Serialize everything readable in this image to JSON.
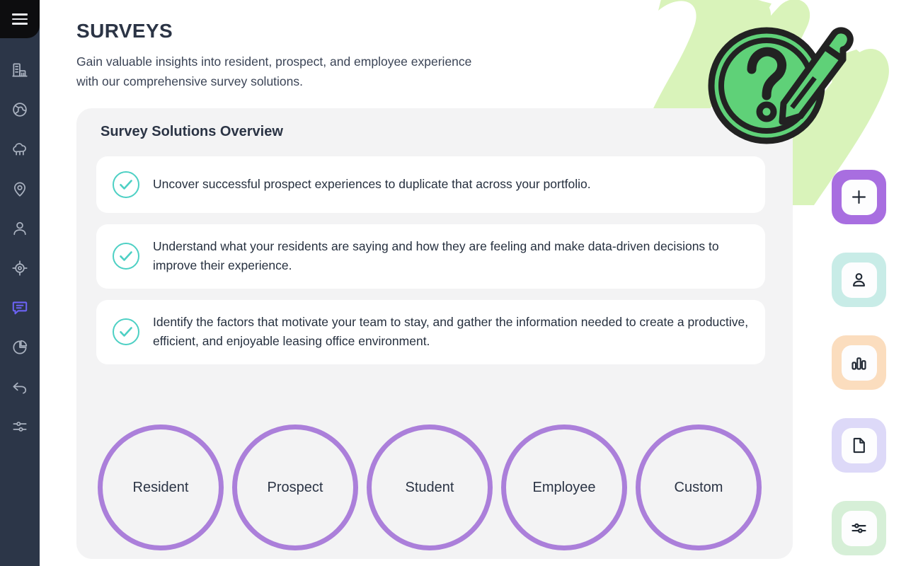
{
  "sidebar": {
    "menu_label": "Menu",
    "items": [
      {
        "name": "sidebar-item-properties",
        "icon": "building-icon",
        "active": false
      },
      {
        "name": "sidebar-item-globe",
        "icon": "globe-icon",
        "active": false
      },
      {
        "name": "sidebar-item-cloud",
        "icon": "cloud-icon",
        "active": false
      },
      {
        "name": "sidebar-item-location",
        "icon": "map-pin-icon",
        "active": false
      },
      {
        "name": "sidebar-item-residents",
        "icon": "user-icon",
        "active": false
      },
      {
        "name": "sidebar-item-target",
        "icon": "target-icon",
        "active": false
      },
      {
        "name": "sidebar-item-surveys",
        "icon": "chat-message-icon",
        "active": true
      },
      {
        "name": "sidebar-item-reports",
        "icon": "pie-chart-icon",
        "active": false
      },
      {
        "name": "sidebar-item-back",
        "icon": "undo-arrow-icon",
        "active": false
      },
      {
        "name": "sidebar-item-settings",
        "icon": "sliders-icon",
        "active": false
      }
    ]
  },
  "header": {
    "title": "SURVEYS",
    "subtitle": "Gain valuable insights into resident, prospect, and employee experience\n with our comprehensive survey solutions."
  },
  "panel": {
    "title": "Survey Solutions Overview",
    "features": [
      "Uncover successful prospect experiences to duplicate that across your portfolio.",
      "Understand what your residents are saying and how they are feeling and make data-driven decisions to improve their experience.",
      "Identify the factors that motivate your team to stay, and gather the information needed to create a productive, efficient, and enjoyable leasing office environment."
    ],
    "survey_types": [
      {
        "label": "Resident"
      },
      {
        "label": "Prospect"
      },
      {
        "label": "Student"
      },
      {
        "label": "Employee"
      },
      {
        "label": "Custom"
      }
    ]
  },
  "action_rail": {
    "buttons": [
      {
        "name": "add-survey-button",
        "icon": "plus-icon",
        "bg": "#a86ee0"
      },
      {
        "name": "contacts-button",
        "icon": "person-icon",
        "bg": "#c8ece7"
      },
      {
        "name": "analytics-button",
        "icon": "bar-chart-icon",
        "bg": "#fbddbe"
      },
      {
        "name": "documents-button",
        "icon": "document-icon",
        "bg": "#ddd9f8"
      },
      {
        "name": "filters-button",
        "icon": "sliders-icon",
        "bg": "#d6efd7"
      }
    ]
  },
  "decor": {
    "brush_color": "#d9f3ba",
    "badge_fill": "#5fd178",
    "badge_stroke": "#222222",
    "icon_name": "question-survey-pencil-icon"
  },
  "colors": {
    "sidebar_bg": "#2c3648",
    "sidebar_top_bg": "#0d0d0f",
    "panel_bg": "#f3f3f4",
    "card_bg": "#ffffff",
    "accent_purple": "#ab7fda",
    "accent_indigo": "#6c63f5",
    "check_teal": "#4dd0c4",
    "text_dark": "#2b3445"
  }
}
